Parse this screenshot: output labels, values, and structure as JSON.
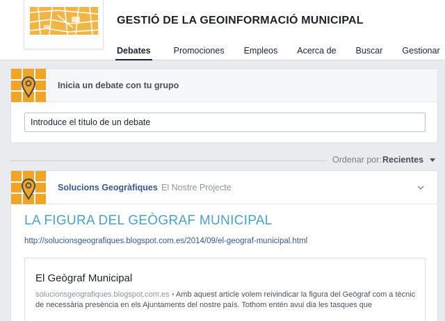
{
  "group": {
    "title": "GESTIÓ DE LA GEOINFORMACIÓ MUNICIPAL"
  },
  "tabs": [
    {
      "label": "Debates",
      "active": true
    },
    {
      "label": "Promociones",
      "active": false
    },
    {
      "label": "Empleos",
      "active": false
    },
    {
      "label": "Acerca de",
      "active": false
    },
    {
      "label": "Buscar",
      "active": false
    },
    {
      "label": "Gestionar",
      "active": false
    }
  ],
  "composer": {
    "label": "Inicia un debate con tu grupo",
    "placeholder": "Introduce el título de un debate"
  },
  "sort": {
    "label": "Ordenar por:",
    "value": "Recientes"
  },
  "post": {
    "author": "Solucions Geogràfiques",
    "sublabel": "El Nostre Projecte",
    "title": "LA FIGURA DEL GEÒGRAF MUNICIPAL",
    "link": "http://solucionsgeografiques.blogspot.com.es/2014/09/el-geograf-municipal.html",
    "preview": {
      "title": "El Geògraf Municipal",
      "domain": "solucionsgeografiques.blogspot.com.es",
      "separator": "•",
      "description": "Amb aquest article volem reivindicar la figura del Geògraf com a tècnic de necessària presència en els Ajuntaments del nostre país. Tothom entén avui dia les tasques que"
    }
  },
  "colors": {
    "accent": "#f0a527",
    "link": "#365899",
    "title_link": "#4a9fd1",
    "background": "#e9ebee"
  },
  "icons": {
    "group": "map-pin-icon",
    "chevron": "chevron-down-icon",
    "sort": "caret-down-icon"
  }
}
